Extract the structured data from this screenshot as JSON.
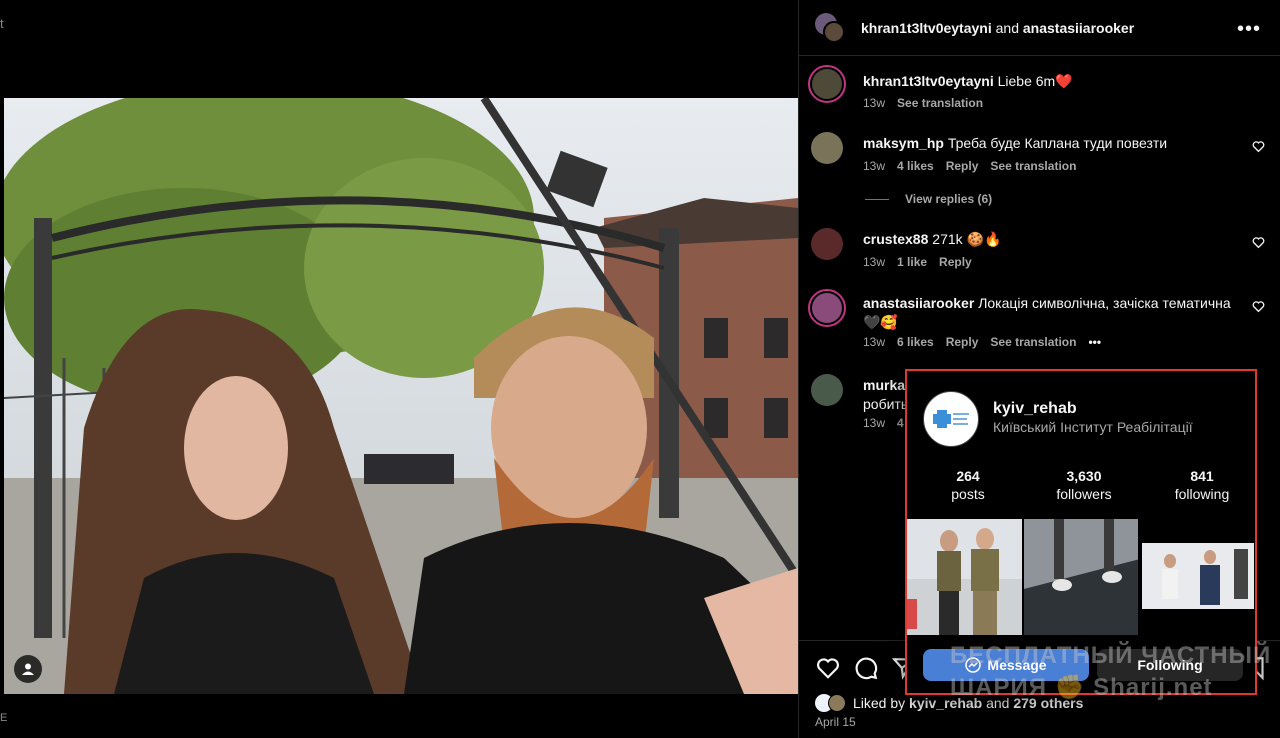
{
  "header": {
    "user1": "khran1t3ltv0eytayni",
    "joiner": "and",
    "user2": "anastasiiarooker",
    "more_icon": "more-horizontal-icon"
  },
  "caption": {
    "username": "khran1t3ltv0eytayni",
    "text": "Liebe 6m❤️",
    "time": "13w",
    "translate": "See translation"
  },
  "comments": [
    {
      "username": "maksym_hp",
      "text": "Треба буде Каплана туди повезти",
      "time": "13w",
      "likes": "4 likes",
      "reply": "Reply",
      "translate": "See translation"
    },
    {
      "username": "crustex88",
      "text": "271k 🍪🔥",
      "time": "13w",
      "likes": "1 like",
      "reply": "Reply"
    },
    {
      "username": "anastasiiarooker",
      "text": "Локація символічна, зачіска тематична 🖤🥰",
      "time": "13w",
      "likes": "6 likes",
      "reply": "Reply",
      "translate": "See translation",
      "more": "•••"
    },
    {
      "username": "murka",
      "text": "робить",
      "time": "13w",
      "likes": "4"
    }
  ],
  "view_replies": "View replies (6)",
  "hover_card": {
    "username": "kyiv_rehab",
    "full_name": "Київський Інститут Реабілітації",
    "posts_count": "264",
    "posts_label": "posts",
    "followers_count": "3,630",
    "followers_label": "followers",
    "following_count": "841",
    "following_label": "following",
    "message_label": "Message",
    "following_button": "Following"
  },
  "likes": {
    "prefix": "Liked by",
    "user": "kyiv_rehab",
    "joiner": "and",
    "others": "279 others"
  },
  "date": "April 15",
  "watermark_line1": "БЕСПЛАТНЫЙ  ЧАСТНЫЙ",
  "watermark_line2": "ШАРИЯ ✊ Sharij.net",
  "colors": {
    "background": "#000000",
    "accent_blue": "#4a7fd6",
    "highlight_border": "#e0392b",
    "secondary_text": "#a8a8a8"
  }
}
